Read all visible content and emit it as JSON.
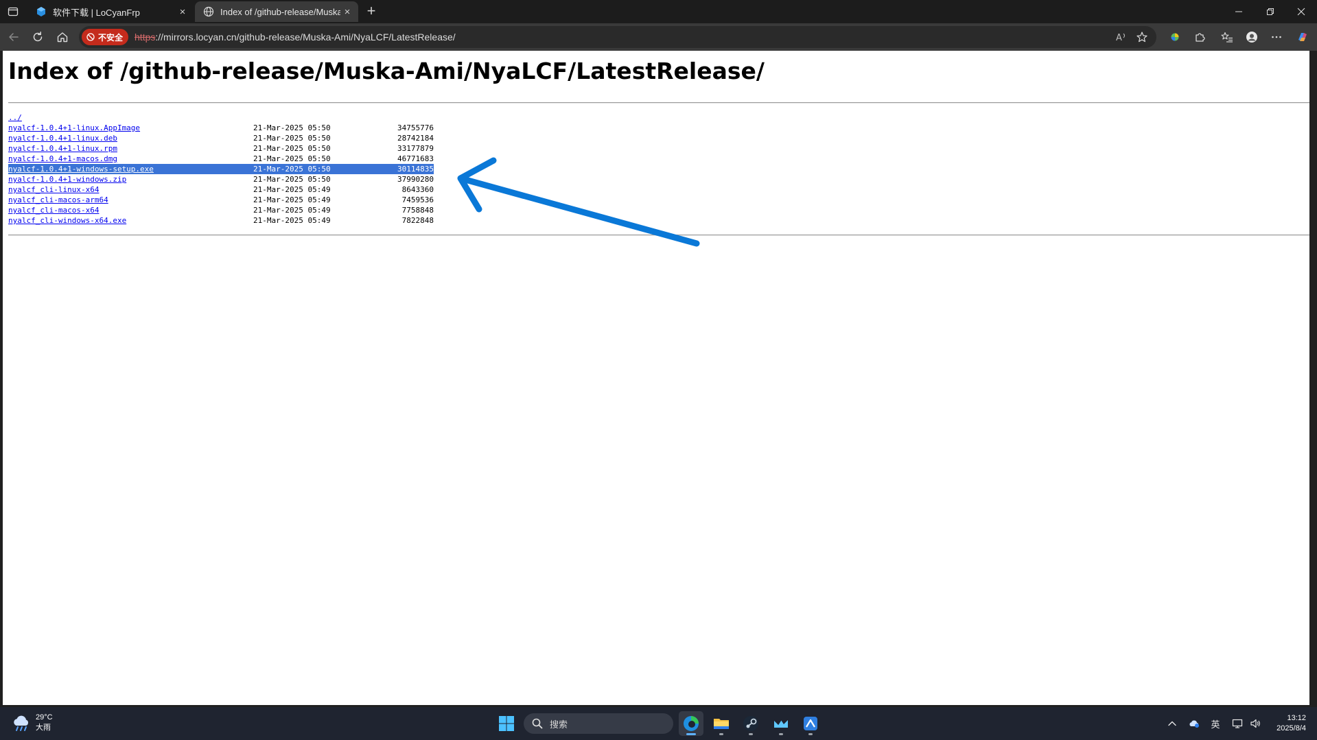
{
  "browser": {
    "tabs": [
      {
        "title": "软件下载 | LoCyanFrp",
        "active": false
      },
      {
        "title": "Index of /github-release/Muska-Ami/NyaLCF/LatestRelease/",
        "active": true
      }
    ],
    "security_label": "不安全",
    "url_scheme": "https",
    "url_rest": "://mirrors.locyan.cn/github-release/Muska-Ami/NyaLCF/LatestRelease/",
    "close_glyph": "×",
    "newtab_glyph": "+"
  },
  "page": {
    "title": "Index of /github-release/Muska-Ami/NyaLCF/LatestRelease/",
    "parent_link": "../",
    "entries": [
      {
        "name": "nyalcf-1.0.4+1-linux.AppImage",
        "date": "21-Mar-2025 05:50",
        "size": "34755776",
        "selected": false
      },
      {
        "name": "nyalcf-1.0.4+1-linux.deb",
        "date": "21-Mar-2025 05:50",
        "size": "28742184",
        "selected": false
      },
      {
        "name": "nyalcf-1.0.4+1-linux.rpm",
        "date": "21-Mar-2025 05:50",
        "size": "33177879",
        "selected": false
      },
      {
        "name": "nyalcf-1.0.4+1-macos.dmg",
        "date": "21-Mar-2025 05:50",
        "size": "46771683",
        "selected": false
      },
      {
        "name": "nyalcf-1.0.4+1-windows-setup.exe",
        "date": "21-Mar-2025 05:50",
        "size": "30114835",
        "selected": true
      },
      {
        "name": "nyalcf-1.0.4+1-windows.zip",
        "date": "21-Mar-2025 05:50",
        "size": "37990280",
        "selected": false
      },
      {
        "name": "nyalcf_cli-linux-x64",
        "date": "21-Mar-2025 05:49",
        "size": "8643360",
        "selected": false
      },
      {
        "name": "nyalcf_cli-macos-arm64",
        "date": "21-Mar-2025 05:49",
        "size": "7459536",
        "selected": false
      },
      {
        "name": "nyalcf_cli-macos-x64",
        "date": "21-Mar-2025 05:49",
        "size": "7758848",
        "selected": false
      },
      {
        "name": "nyalcf_cli-windows-x64.exe",
        "date": "21-Mar-2025 05:49",
        "size": "7822848",
        "selected": false
      }
    ],
    "highlight_color": "#3a73d6",
    "link_color": "#0000ee",
    "annotation_arrow_color": "#0a78d7"
  },
  "taskbar": {
    "weather_temp": "29°C",
    "weather_desc": "大雨",
    "search_placeholder": "搜索",
    "ime_label": "英",
    "time": "13:12",
    "date": "2025/8/4",
    "apps": [
      "edge-icon",
      "file-explorer-icon",
      "steam-icon",
      "app-icon",
      "app-icon"
    ]
  }
}
